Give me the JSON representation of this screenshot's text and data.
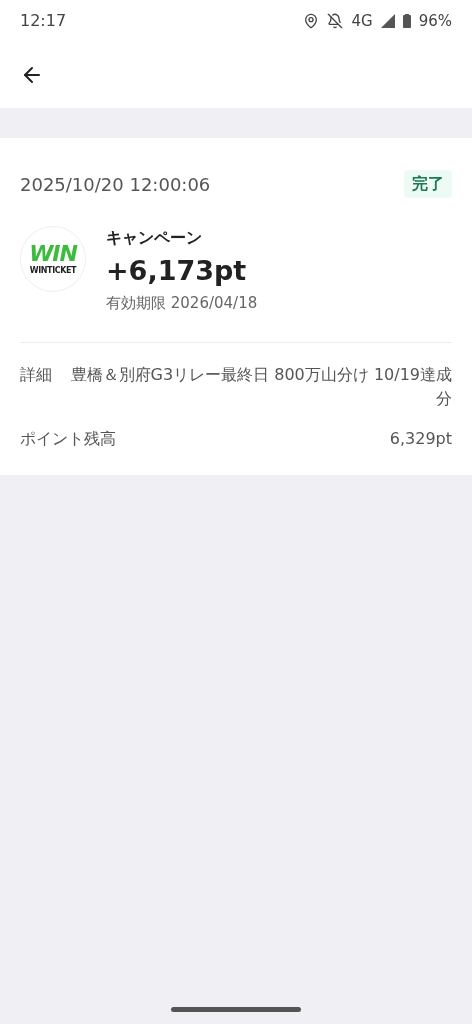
{
  "status_bar": {
    "time": "12:17",
    "network": "4G",
    "battery": "96%"
  },
  "transaction": {
    "datetime": "2025/10/20 12:00:06",
    "status": "完了",
    "logo": {
      "mark": "WIN",
      "name": "WINTICKET"
    },
    "category": "キャンペーン",
    "amount": "+6,173pt",
    "expiry": "有効期限 2026/04/18"
  },
  "details": [
    {
      "label": "詳細",
      "value": "豊橋＆別府G3リレー最終日 800万山分け 10/19達成分"
    },
    {
      "label": "ポイント残高",
      "value": "6,329pt"
    }
  ]
}
